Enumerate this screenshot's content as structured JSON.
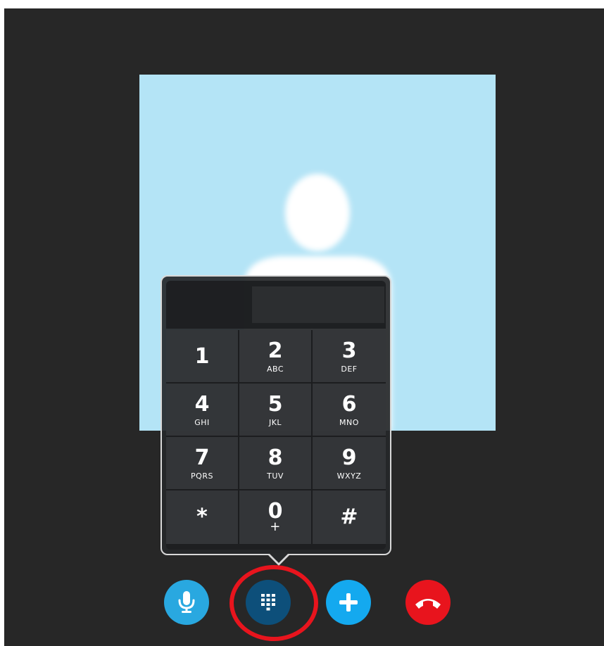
{
  "colors": {
    "window_bg": "#272727",
    "avatar_bg": "#b4e4f6",
    "mic_button": "#29a8e0",
    "dialpad_button": "#0d4f7a",
    "add_button": "#14a9ef",
    "end_call_button": "#e8141d",
    "highlight_ring": "#e8141d"
  },
  "dialpad": {
    "input_value": "",
    "keys": [
      {
        "digit": "1",
        "letters": ""
      },
      {
        "digit": "2",
        "letters": "ABC"
      },
      {
        "digit": "3",
        "letters": "DEF"
      },
      {
        "digit": "4",
        "letters": "GHI"
      },
      {
        "digit": "5",
        "letters": "JKL"
      },
      {
        "digit": "6",
        "letters": "MNO"
      },
      {
        "digit": "7",
        "letters": "PQRS"
      },
      {
        "digit": "8",
        "letters": "TUV"
      },
      {
        "digit": "9",
        "letters": "WXYZ"
      },
      {
        "digit": "*",
        "letters": ""
      },
      {
        "digit": "0",
        "letters": "+"
      },
      {
        "digit": "#",
        "letters": ""
      }
    ]
  },
  "controls": {
    "mic_icon": "microphone-icon",
    "dialpad_icon": "dialpad-icon",
    "add_icon": "plus-icon",
    "end_call_icon": "hang-up-icon"
  }
}
